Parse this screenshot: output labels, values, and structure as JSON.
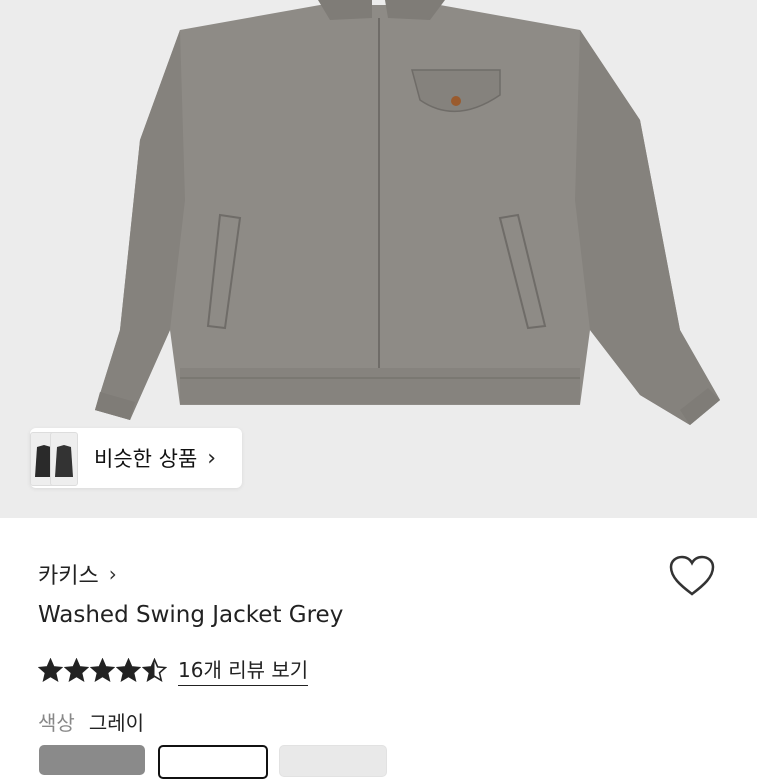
{
  "similar": {
    "label": "비슷한 상품",
    "chevron": "›"
  },
  "product": {
    "brand": "카키스",
    "brand_chevron": "›",
    "title": "Washed Swing Jacket Grey",
    "rating": 4.5,
    "review_link": "16개 리뷰 보기",
    "color_label": "색상",
    "color_value": "그레이",
    "swatches": [
      "#8a8a8a",
      "#ffffff",
      "#e9e9e9"
    ]
  },
  "icons": {
    "heart": "heart-icon",
    "star": "star-icon"
  }
}
